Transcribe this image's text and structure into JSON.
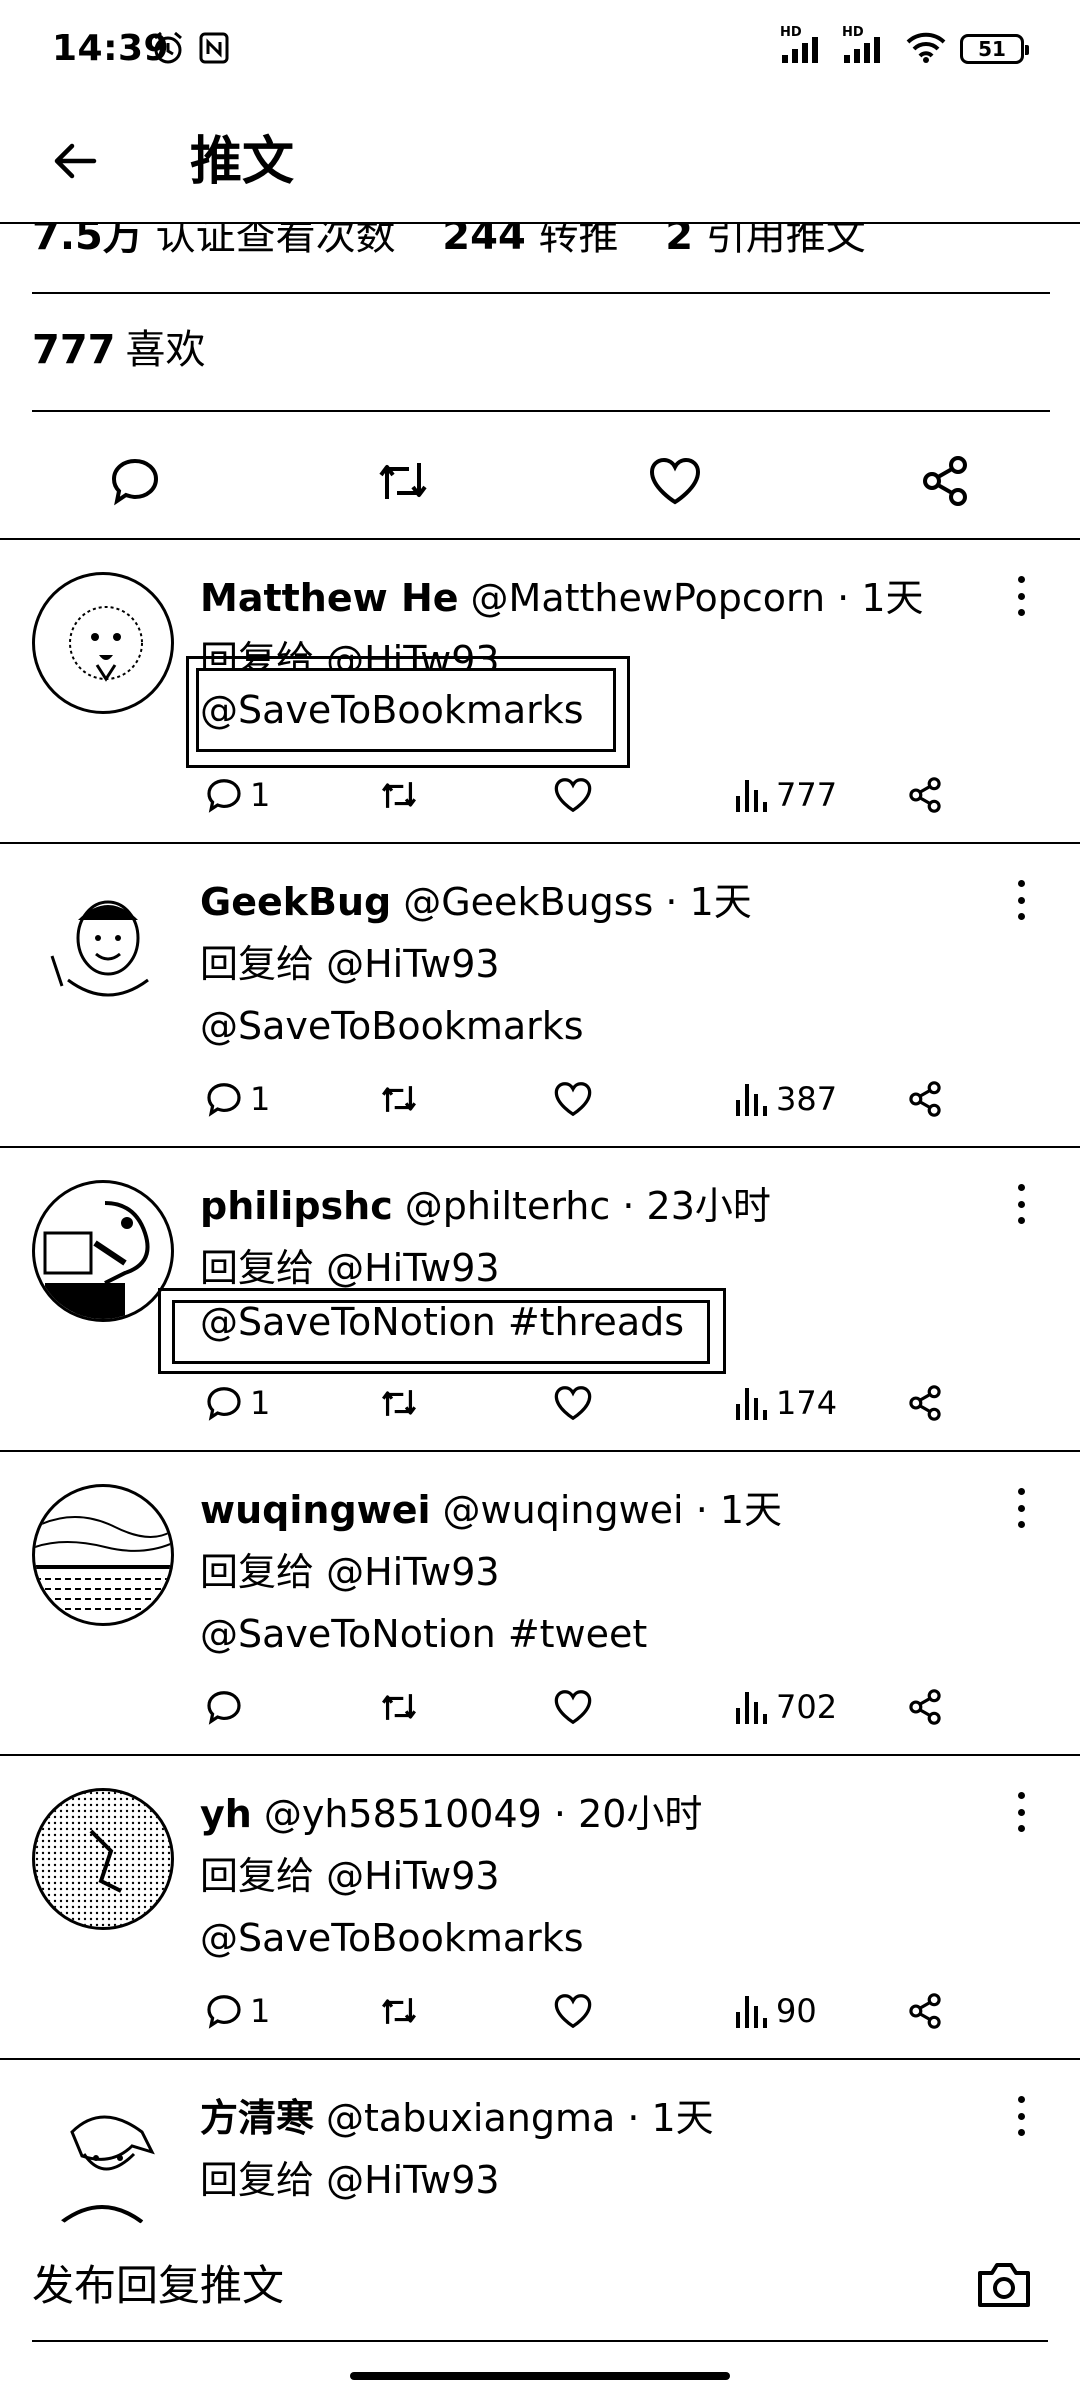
{
  "status_bar": {
    "time": "14:39",
    "battery": "51",
    "signal_1_label": "HD",
    "signal_2_label": "HD"
  },
  "header": {
    "title": "推文"
  },
  "stats": {
    "views_value": "7.5万",
    "views_label": "认证查看次数",
    "retweets_value": "244",
    "retweets_label": "转推",
    "quotes_value": "2",
    "quotes_label": "引用推文",
    "likes_value": "777",
    "likes_label": "喜欢"
  },
  "replies": [
    {
      "name": "Matthew He",
      "handle": "@MatthewPopcorn",
      "time": "· 1天",
      "reply_to": "回复给 @HiTw93",
      "text": "@SaveToBookmarks",
      "comments": "1",
      "views": "777"
    },
    {
      "name": "GeekBug",
      "handle": "@GeekBugss",
      "time": "· 1天",
      "reply_to": "回复给 @HiTw93",
      "text": "@SaveToBookmarks",
      "comments": "1",
      "views": "387"
    },
    {
      "name": "philipshc",
      "handle": "@philterhc",
      "time": "· 23小时",
      "reply_to": "回复给 @HiTw93",
      "text": "@SaveToNotion #threads",
      "comments": "1",
      "views": "174"
    },
    {
      "name": "wuqingwei",
      "handle": "@wuqingwei",
      "time": "· 1天",
      "reply_to": "回复给 @HiTw93",
      "text": "@SaveToNotion #tweet",
      "comments": "",
      "views": "702"
    },
    {
      "name": "yh",
      "handle": "@yh58510049",
      "time": "· 20小时",
      "reply_to": "回复给 @HiTw93",
      "text": "@SaveToBookmarks",
      "comments": "1",
      "views": "90"
    },
    {
      "name": "方清寒",
      "handle": "@tabuxiangma",
      "time": "· 1天",
      "reply_to": "回复给 @HiTw93",
      "text": "",
      "comments": "",
      "views": ""
    }
  ],
  "compose": {
    "placeholder": "发布回复推文"
  },
  "icons": {
    "back": "arrow-left-icon",
    "comment": "comment-icon",
    "retweet": "retweet-icon",
    "like": "heart-icon",
    "share": "share-icon",
    "views": "bar-chart-icon",
    "more": "more-vertical-icon",
    "camera": "camera-icon"
  }
}
